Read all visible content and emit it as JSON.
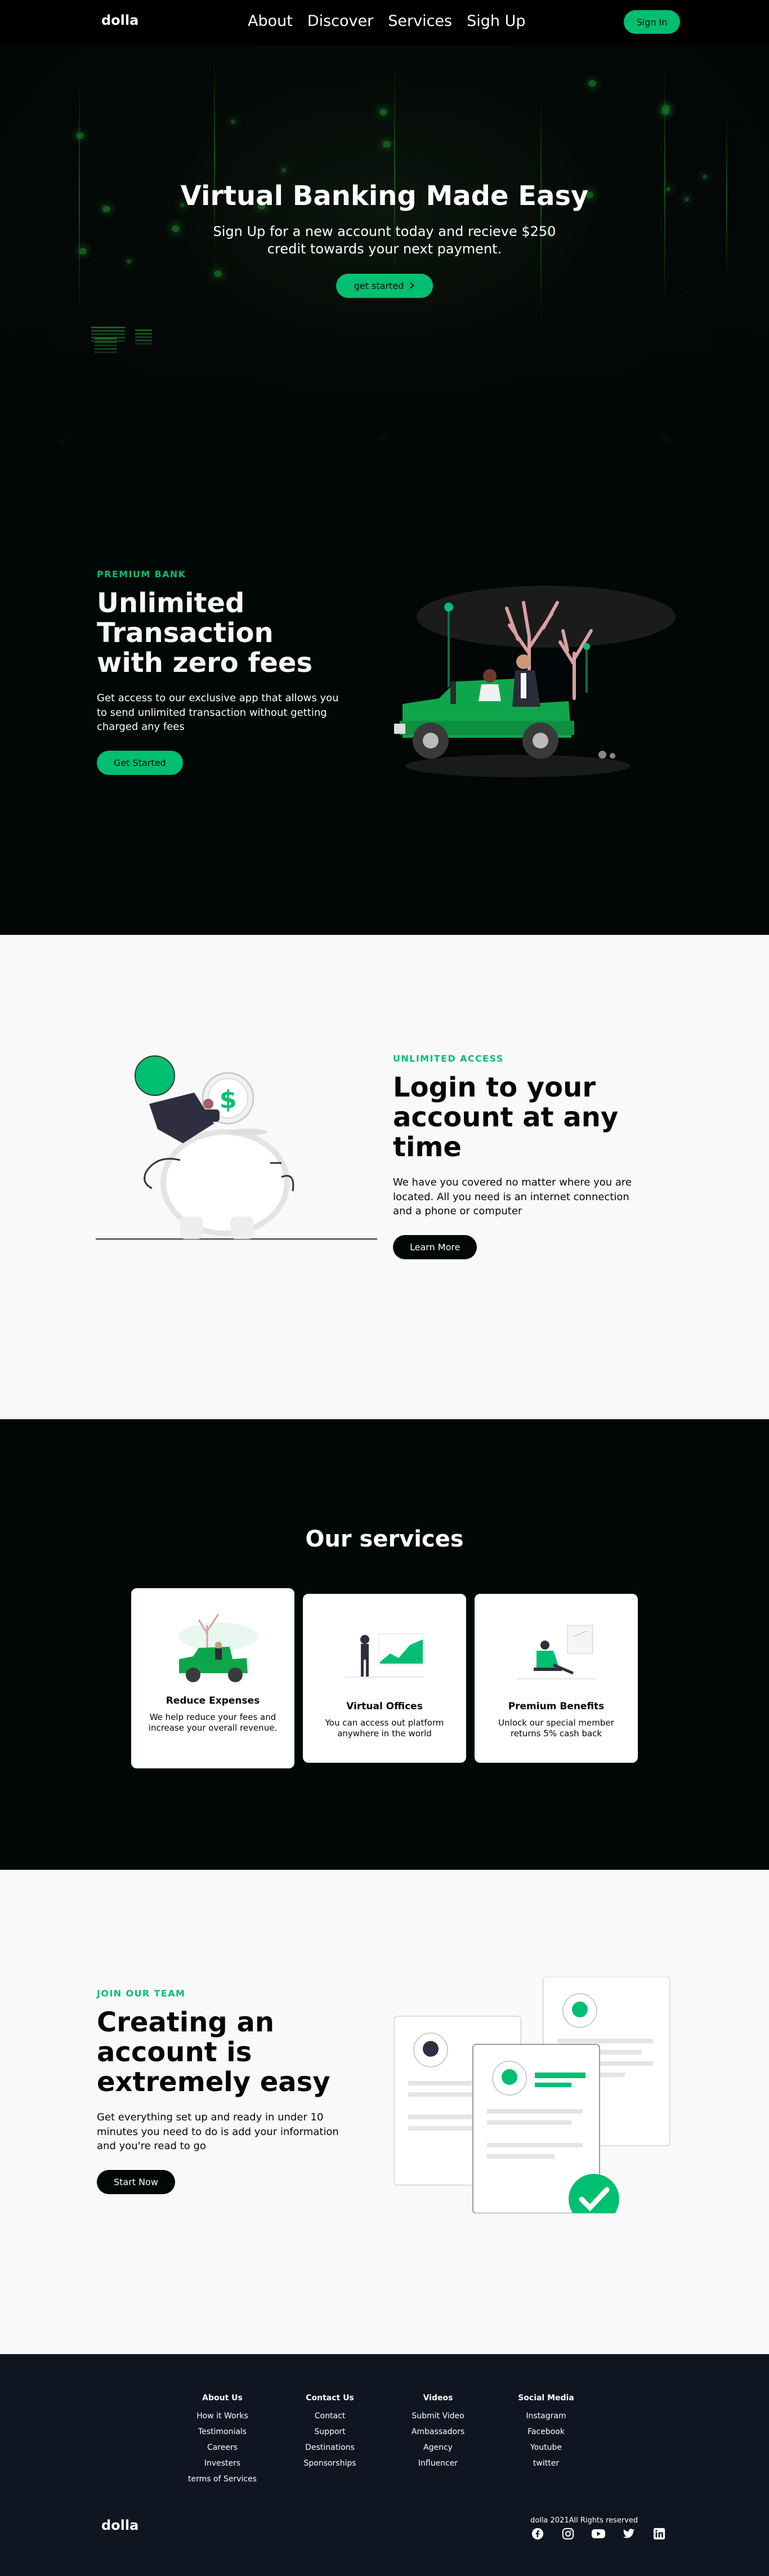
{
  "nav": {
    "logo": "dolla",
    "links": [
      "About",
      "Discover",
      "Services",
      "Sigh Up"
    ],
    "signin": "Sign In"
  },
  "hero": {
    "title": "Virtual Banking Made Easy",
    "subtitle": "Sign Up for a new account today and recieve $250 credit towards your next payment.",
    "button": "get started",
    "button_icon": "chevron-right-icon"
  },
  "about": {
    "topline": "Premium Bank",
    "heading": "Unlimited Transaction with zero fees",
    "description": "Get access to our exclusive app that allows you to send unlimited transaction without getting charged any fees",
    "button": "Get Started"
  },
  "discover": {
    "topline": "Unlimited Access",
    "heading": "Login to your account at any time",
    "description": "We have you covered no matter where you are located. All you need is an internet connection and a phone or computer",
    "button": "Learn More"
  },
  "services": {
    "heading": "Our services",
    "cards": [
      {
        "title": "Reduce Expenses",
        "text": "We help reduce your fees and increase your overall revenue.",
        "icon": "car-illustration-icon"
      },
      {
        "title": "Virtual Offices",
        "text": "You can access out platform anywhere in the world",
        "icon": "chart-illustration-icon"
      },
      {
        "title": "Premium Benefits",
        "text": "Unlock our special member returns 5% cash back",
        "icon": "relax-illustration-icon"
      }
    ]
  },
  "signup": {
    "topline": "Join our Team",
    "heading": "Creating an account is extremely easy",
    "description": "Get everything set up and ready in under 10 minutes you need to do is add your information and you're read to go",
    "button": "Start Now"
  },
  "footer": {
    "columns": [
      {
        "title": "About Us",
        "links": [
          "How it Works",
          "Testimonials",
          "Careers",
          "Investers",
          "terms of Services"
        ]
      },
      {
        "title": "Contact Us",
        "links": [
          "Contact",
          "Support",
          "Destinations",
          "Sponsorships"
        ]
      },
      {
        "title": "Videos",
        "links": [
          "Submit Video",
          "Ambassadors",
          "Agency",
          "Influencer"
        ]
      },
      {
        "title": "Social Media",
        "links": [
          "Instagram",
          "Facebook",
          "Youtube",
          "twitter"
        ]
      }
    ],
    "logo": "dolla",
    "copyright": "dolla 2021All Rights reserved",
    "socials": [
      "facebook-icon",
      "instagram-icon",
      "youtube-icon",
      "twitter-icon",
      "linkedin-icon"
    ]
  },
  "colors": {
    "accent": "#01bf71",
    "dark": "#010606",
    "light": "#f9f9f9",
    "footer": "#101522"
  }
}
